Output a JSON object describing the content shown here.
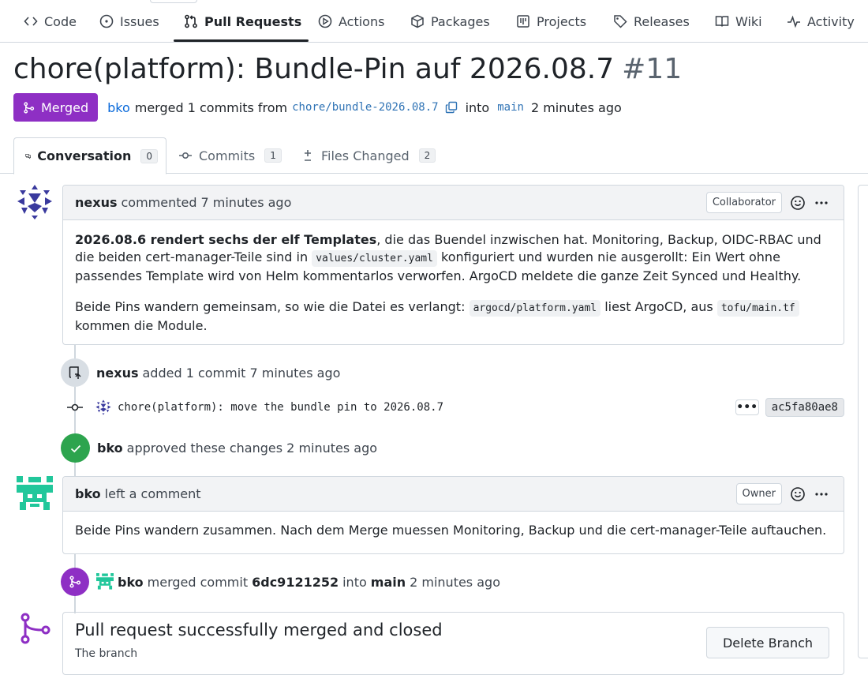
{
  "nav": {
    "items": [
      {
        "label": "Code",
        "icon": "code-icon"
      },
      {
        "label": "Issues",
        "icon": "issue-icon"
      },
      {
        "label": "Pull Requests",
        "icon": "pull-request-icon",
        "active": true
      },
      {
        "label": "Actions",
        "icon": "play-icon"
      },
      {
        "label": "Packages",
        "icon": "package-icon"
      },
      {
        "label": "Projects",
        "icon": "project-icon"
      },
      {
        "label": "Releases",
        "icon": "tag-icon"
      },
      {
        "label": "Wiki",
        "icon": "book-icon"
      },
      {
        "label": "Activity",
        "icon": "pulse-icon"
      }
    ]
  },
  "pr": {
    "title": "chore(platform): Bundle-Pin auf 2026.08.7",
    "number": "#11",
    "state": "Merged",
    "author": "bko",
    "merged_text": "merged 1 commits from",
    "head_branch": "chore/bundle-2026.08.7",
    "into_text": "into",
    "base_branch": "main",
    "time": "2 minutes ago"
  },
  "tabs": [
    {
      "label": "Conversation",
      "count": "0",
      "icon": "conversation-icon"
    },
    {
      "label": "Commits",
      "count": "1",
      "icon": "commit-icon"
    },
    {
      "label": "Files Changed",
      "count": "2",
      "icon": "diff-icon"
    }
  ],
  "comment1": {
    "author": "nexus",
    "action": "commented",
    "time": "7 minutes ago",
    "role": "Collaborator",
    "p1_bold": "2026.08.6 rendert sechs der elf Templates",
    "p1_a": ", die das Buendel inzwischen hat. Monitoring, Backup, OIDC-RBAC und die beiden cert-manager-Teile sind in ",
    "p1_code": "values/cluster.yaml",
    "p1_b": " konfiguriert und wurden nie ausgerollt: Ein Wert ohne passendes Template wird von Helm kommentarlos verworfen. ArgoCD meldete die ganze Zeit Synced und Healthy.",
    "p2_a": "Beide Pins wandern gemeinsam, so wie die Datei es verlangt: ",
    "p2_code1": "argocd/platform.yaml",
    "p2_b": " liest ArgoCD, aus ",
    "p2_code2": "tofu/main.tf",
    "p2_c": " kommen die Module."
  },
  "event_commit": {
    "author": "nexus",
    "text": "added 1 commit 7 minutes ago",
    "commit_message": "chore(platform): move the bundle pin to 2026.08.7",
    "more": "•••",
    "sha": "ac5fa80ae8"
  },
  "event_approve": {
    "author": "bko",
    "text": "approved these changes 2 minutes ago"
  },
  "comment2": {
    "author": "bko",
    "action": "left a comment",
    "role": "Owner",
    "body": "Beide Pins wandern zusammen. Nach dem Merge muessen Monitoring, Backup und die cert-manager-Teile auftauchen."
  },
  "event_merge": {
    "author": "bko",
    "text_a": "merged commit",
    "sha": "6dc9121252",
    "text_b": "into",
    "branch": "main",
    "time": "2 minutes ago"
  },
  "merge_box": {
    "title": "Pull request successfully merged and closed",
    "subtitle": "The branch",
    "delete_button": "Delete Branch"
  },
  "colors": {
    "merged": "#8e2fc4",
    "approved": "#2da44e",
    "link": "#0969da",
    "avatar_nexus": "#3a3a9e",
    "avatar_bko": "#21c79b"
  }
}
